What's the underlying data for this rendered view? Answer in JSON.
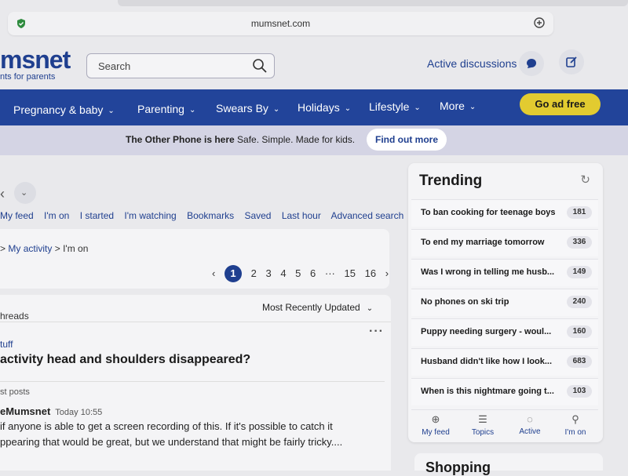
{
  "browser": {
    "domain": "mumsnet.com"
  },
  "header": {
    "logo": "msnet",
    "tagline": "nts for parents",
    "search_placeholder": "Search",
    "active_discussions": "Active discussions"
  },
  "nav": {
    "items": [
      {
        "label": "Pregnancy & baby"
      },
      {
        "label": "Parenting"
      },
      {
        "label": "Swears By"
      },
      {
        "label": "Holidays"
      },
      {
        "label": "Lifestyle"
      },
      {
        "label": "More"
      }
    ],
    "chevron": "⌄",
    "ad_free": "Go ad free"
  },
  "promo": {
    "bold": "The Other Phone is here",
    "rest": "Safe. Simple. Made for kids.",
    "button": "Find out more"
  },
  "feed_tabs": [
    "My feed",
    "I'm on",
    "I started",
    "I'm watching",
    "Bookmarks",
    "Saved",
    "Last hour",
    "Advanced search"
  ],
  "breadcrumb": {
    "sep": ">",
    "link": "My activity",
    "current": "I'm on"
  },
  "pagination": {
    "prev": "‹",
    "current": "1",
    "pages": [
      "2",
      "3",
      "4",
      "5",
      "6"
    ],
    "ellipsis": "···",
    "tail": [
      "15",
      "16"
    ],
    "next": "›"
  },
  "threads": {
    "label": "hreads",
    "sort": "Most Recently Updated",
    "topic": "tuff",
    "title": "activity head and shoulders disappeared?",
    "latest_label": "st posts",
    "author": "eMumsnet",
    "time": "Today 10:55",
    "body_line1": "if anyone is able to get a screen recording of this. If it's possible to catch it",
    "body_line2": "ppearing that would be great, but we understand that might be fairly tricky...."
  },
  "trending": {
    "title": "Trending",
    "items": [
      {
        "title": "To ban cooking for teenage boys",
        "count": "181"
      },
      {
        "title": "To end my marriage tomorrow",
        "count": "336"
      },
      {
        "title": "Was I wrong in telling me husb...",
        "count": "149"
      },
      {
        "title": "No phones on ski trip",
        "count": "240"
      },
      {
        "title": "Puppy needing surgery - woul...",
        "count": "160"
      },
      {
        "title": "Husband didn't like how I look...",
        "count": "683"
      },
      {
        "title": "When is this nightmare going t...",
        "count": "103"
      }
    ],
    "tabs": [
      "My feed",
      "Topics",
      "Active",
      "I'm on"
    ]
  },
  "shopping": {
    "title": "Shopping"
  },
  "colors": {
    "brand": "#22449a",
    "ad_free": "#e2cb30",
    "link": "#1f3f8f"
  }
}
